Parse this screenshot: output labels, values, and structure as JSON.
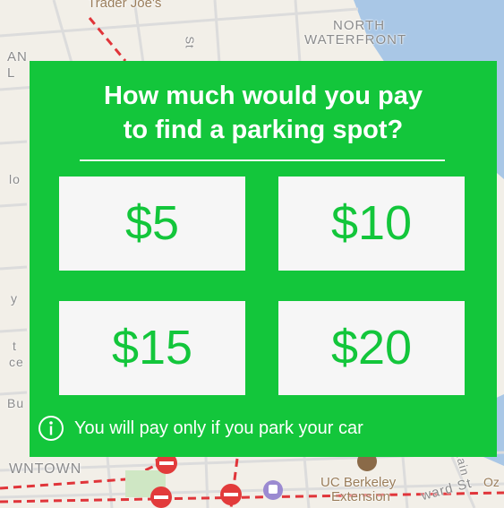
{
  "map": {
    "labels": {
      "trader_joes": "Trader Joe's",
      "north": "NORTH",
      "waterfront": "WATERFRONT",
      "downtown": "WNTOWN",
      "uc_berkeley": "UC Berkeley",
      "extension": "Extension",
      "ward_st": "ward St",
      "street_fragment": "St",
      "left_fragment_1": "AN",
      "left_fragment_2": "L",
      "left_fragment_3": "lo",
      "left_fragment_4": "y",
      "left_fragment_5": "t",
      "left_fragment_6": "ce",
      "left_fragment_7": "Bu",
      "main_fragment": "Main",
      "oz_fragment": "Oz"
    }
  },
  "prompt": {
    "title_line1": "How much would you pay",
    "title_line2": "to find a parking spot?",
    "options": [
      {
        "label": "$5"
      },
      {
        "label": "$10"
      },
      {
        "label": "$15"
      },
      {
        "label": "$20"
      }
    ],
    "info_icon": "info-icon",
    "info_text": "You will pay only if you park your car"
  },
  "colors": {
    "card_background": "#13c63b",
    "button_background": "#f6f6f6",
    "button_text": "#13c63b",
    "title_text": "#ffffff"
  }
}
